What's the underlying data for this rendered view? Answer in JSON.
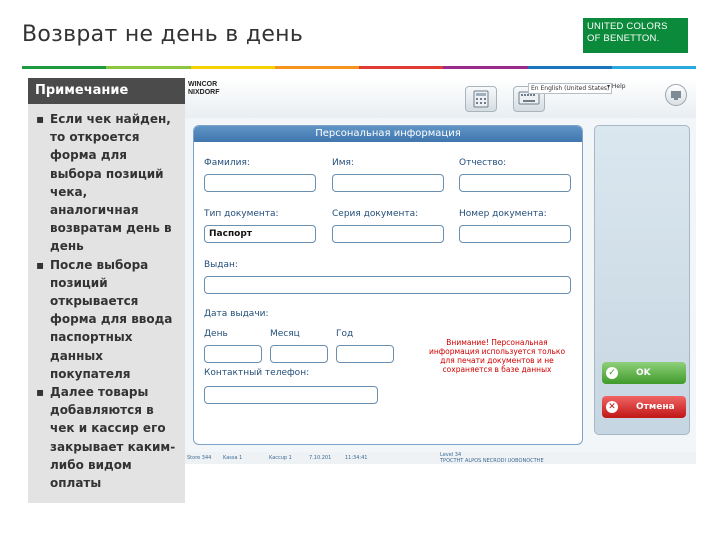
{
  "slide": {
    "title": "Возврат не день в день"
  },
  "logo": {
    "line1": "UNITED COLORS",
    "line2": "OF BENETTON.",
    "color": "#0a8a3a"
  },
  "colorbar": [
    "#1d9a3f",
    "#8cc63f",
    "#f4d100",
    "#f7941d",
    "#e03c31",
    "#9b2a8a",
    "#1b75bc",
    "#29a9e0"
  ],
  "note": {
    "title": "Примечание",
    "items": [
      "Если чек найден, то откроется форма для выбора позиций чека, аналогичная возвратам день в день",
      "После выбора позиций открывается форма для ввода паспортных данных покупателя",
      "Далее товары добавляются в чек и кассир его закрывает каким-либо видом оплаты"
    ]
  },
  "app": {
    "brand_line1": "WINCOR",
    "brand_line2": "NIXDORF",
    "icons": [
      "calculator-icon",
      "keyboard-icon",
      "monitor-icon"
    ],
    "language": "En English (United States)",
    "help": "Help",
    "form": {
      "title": "Персональная информация",
      "surname_label": "Фамилия:",
      "name_label": "Имя:",
      "patronymic_label": "Отчество:",
      "doc_type_label": "Тип документа:",
      "doc_type_value": "Паспорт",
      "doc_series_label": "Серия документа:",
      "doc_number_label": "Номер документа:",
      "issued_by_label": "Выдан:",
      "issue_date_label": "Дата выдачи:",
      "day_label": "День",
      "month_label": "Месяц",
      "year_label": "Год",
      "phone_label": "Контактный телефон:",
      "warning": "Внимание! Персональная информация используется только для печати документов и не сохраняется в базе данных"
    },
    "buttons": {
      "ok": "OK",
      "cancel": "Отмена"
    },
    "status": {
      "store": "Store 344",
      "register": "Kassa 1",
      "cashier": "Kaccup 1",
      "date": "7.10.201",
      "time": "11:34:41",
      "version": "Level 34",
      "product": "TPOCTHT ALPOS NECRODI UOBONOCTHE"
    }
  }
}
